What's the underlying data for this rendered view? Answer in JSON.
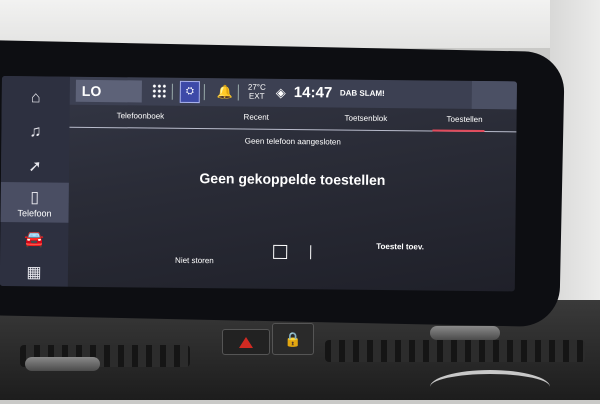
{
  "status_bar": {
    "profile_label": "LO",
    "seat_label": "⛭",
    "temp_top": "27°C",
    "temp_bottom": "EXT",
    "clock": "14:47",
    "radio": "DAB SLAM!"
  },
  "sidebar": {
    "items": [
      {
        "icon": "home-icon",
        "glyph": "⌂",
        "label": ""
      },
      {
        "icon": "music-icon",
        "glyph": "♫",
        "label": ""
      },
      {
        "icon": "navigation-icon",
        "glyph": "➚",
        "label": ""
      },
      {
        "icon": "phone-icon",
        "glyph": "▯",
        "label": "Telefoon"
      },
      {
        "icon": "car-icon",
        "glyph": "🚘",
        "label": ""
      },
      {
        "icon": "apps-grid-icon",
        "glyph": "▦",
        "label": ""
      }
    ]
  },
  "tabs": [
    {
      "label": "Telefoonboek"
    },
    {
      "label": "Recent"
    },
    {
      "label": "Toetsenblok"
    },
    {
      "label": "Toestellen"
    }
  ],
  "active_tab": "Toestellen",
  "main": {
    "status_line": "Geen telefoon aangesloten",
    "message": "Geen gekoppelde toestellen"
  },
  "bottom": {
    "do_not_disturb_label": "Niet storen",
    "add_device_label": "Toestel toev."
  },
  "colors": {
    "tab_underline": "#e34a5b",
    "screen_bg": "#2a2c37",
    "hazard": "#d12a22"
  }
}
